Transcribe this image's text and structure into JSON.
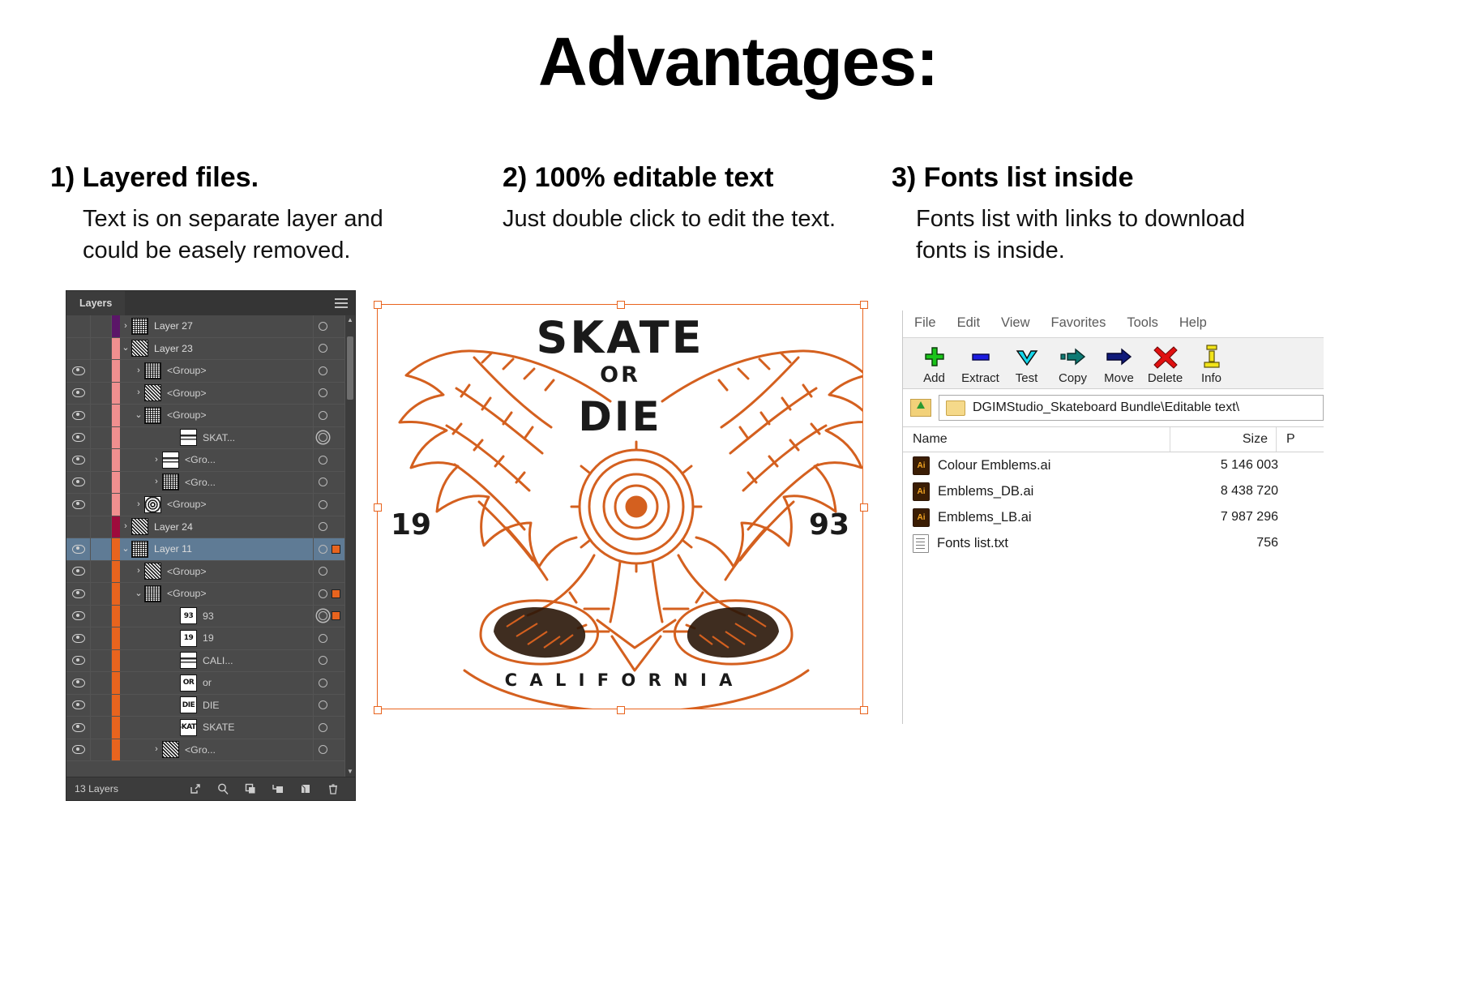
{
  "headline": "Advantages:",
  "columns": [
    {
      "title": "1) Layered files.",
      "body": "Text is on separate layer and could be easely removed."
    },
    {
      "title": "2) 100% editable text",
      "body": "Just double click to edit the text."
    },
    {
      "title": "3) Fonts list inside",
      "body": "Fonts list with links to download fonts is inside."
    }
  ],
  "layers_panel": {
    "tab_label": "Layers",
    "menu_icon": "hamburger-icon",
    "footer_count": "13 Layers",
    "footer_buttons": [
      "locate-object-icon",
      "make-clipping-mask-icon",
      "create-new-sublayer-icon",
      "create-new-layer-icon",
      "delete-selection-icon"
    ],
    "rows": [
      {
        "name": "Layer 27",
        "indent": 0,
        "arrow": ">",
        "eye": false,
        "color": "#5b1668",
        "selected": false,
        "thumb": "noise",
        "thumb_text": "",
        "extra_swatch": false,
        "target": "single"
      },
      {
        "name": "Layer 23",
        "indent": 0,
        "arrow": "v",
        "eye": false,
        "color": "#f08f8f",
        "selected": false,
        "thumb": "noise2",
        "thumb_text": "",
        "extra_swatch": false,
        "target": "single"
      },
      {
        "name": "<Group>",
        "indent": 1,
        "arrow": ">",
        "eye": true,
        "color": "#f08f8f",
        "selected": false,
        "thumb": "noise",
        "thumb_text": "",
        "extra_swatch": false,
        "target": "single"
      },
      {
        "name": "<Group>",
        "indent": 1,
        "arrow": ">",
        "eye": true,
        "color": "#f08f8f",
        "selected": false,
        "thumb": "noise2",
        "thumb_text": "",
        "extra_swatch": false,
        "target": "single"
      },
      {
        "name": "<Group>",
        "indent": 1,
        "arrow": "v",
        "eye": true,
        "color": "#f08f8f",
        "selected": false,
        "thumb": "noise",
        "thumb_text": "",
        "extra_swatch": false,
        "target": "single"
      },
      {
        "name": "SKAT...",
        "indent": 3,
        "arrow": "",
        "eye": true,
        "color": "#f08f8f",
        "selected": false,
        "thumb": "thin",
        "thumb_text": "",
        "extra_swatch": false,
        "target": "double"
      },
      {
        "name": "<Gro...",
        "indent": 2,
        "arrow": ">",
        "eye": true,
        "color": "#f08f8f",
        "selected": false,
        "thumb": "thin",
        "thumb_text": "",
        "extra_swatch": false,
        "target": "single"
      },
      {
        "name": "<Gro...",
        "indent": 2,
        "arrow": ">",
        "eye": true,
        "color": "#f08f8f",
        "selected": false,
        "thumb": "noise",
        "thumb_text": "",
        "extra_swatch": false,
        "target": "single"
      },
      {
        "name": "<Group>",
        "indent": 1,
        "arrow": ">",
        "eye": true,
        "color": "#f08f8f",
        "selected": false,
        "thumb": "ring",
        "thumb_text": "",
        "extra_swatch": false,
        "target": "single"
      },
      {
        "name": "Layer 24",
        "indent": 0,
        "arrow": ">",
        "eye": false,
        "color": "#9e0b3c",
        "selected": false,
        "thumb": "noise2",
        "thumb_text": "",
        "extra_swatch": false,
        "target": "single"
      },
      {
        "name": "Layer 11",
        "indent": 0,
        "arrow": "v",
        "eye": true,
        "color": "#e8641e",
        "selected": true,
        "thumb": "noise",
        "thumb_text": "",
        "extra_swatch": true,
        "target": "single"
      },
      {
        "name": "<Group>",
        "indent": 1,
        "arrow": ">",
        "eye": true,
        "color": "#e8641e",
        "selected": false,
        "thumb": "noise2",
        "thumb_text": "",
        "extra_swatch": false,
        "target": "single"
      },
      {
        "name": "<Group>",
        "indent": 1,
        "arrow": "v",
        "eye": true,
        "color": "#e8641e",
        "selected": false,
        "thumb": "noise",
        "thumb_text": "",
        "extra_swatch": true,
        "target": "single"
      },
      {
        "name": "93",
        "indent": 3,
        "arrow": "",
        "eye": true,
        "color": "#e8641e",
        "selected": false,
        "thumb": "text",
        "thumb_text": "93",
        "extra_swatch": true,
        "target": "double"
      },
      {
        "name": "19",
        "indent": 3,
        "arrow": "",
        "eye": true,
        "color": "#e8641e",
        "selected": false,
        "thumb": "text",
        "thumb_text": "19",
        "extra_swatch": false,
        "target": "single"
      },
      {
        "name": "CALI...",
        "indent": 3,
        "arrow": "",
        "eye": true,
        "color": "#e8641e",
        "selected": false,
        "thumb": "thin",
        "thumb_text": "",
        "extra_swatch": false,
        "target": "single"
      },
      {
        "name": "or",
        "indent": 3,
        "arrow": "",
        "eye": true,
        "color": "#e8641e",
        "selected": false,
        "thumb": "text",
        "thumb_text": "OR",
        "extra_swatch": false,
        "target": "single"
      },
      {
        "name": "DIE",
        "indent": 3,
        "arrow": "",
        "eye": true,
        "color": "#e8641e",
        "selected": false,
        "thumb": "text",
        "thumb_text": "DIE",
        "extra_swatch": false,
        "target": "single"
      },
      {
        "name": "SKATE",
        "indent": 3,
        "arrow": "",
        "eye": true,
        "color": "#e8641e",
        "selected": false,
        "thumb": "text",
        "thumb_text": "SKATE",
        "extra_swatch": false,
        "target": "single"
      },
      {
        "name": "<Gro...",
        "indent": 2,
        "arrow": ">",
        "eye": true,
        "color": "#e8641e",
        "selected": false,
        "thumb": "noise2",
        "thumb_text": "",
        "extra_swatch": false,
        "target": "single"
      }
    ]
  },
  "artwork": {
    "title_line1": "SKATE",
    "title_line2": "OR",
    "title_line3": "DIE",
    "year_left": "19",
    "year_right": "93",
    "bottom_arc": "C A L I F O R N I A",
    "accent_color": "#d4601f"
  },
  "file_manager": {
    "menu": [
      "File",
      "Edit",
      "View",
      "Favorites",
      "Tools",
      "Help"
    ],
    "toolbar": [
      {
        "label": "Add",
        "icon": "plus-icon",
        "color": "#19c419"
      },
      {
        "label": "Extract",
        "icon": "minus-icon",
        "color": "#1c1ce0"
      },
      {
        "label": "Test",
        "icon": "checkmark-icon",
        "color": "#16d6ea"
      },
      {
        "label": "Copy",
        "icon": "copy-arrow-icon",
        "color": "#0d7a74"
      },
      {
        "label": "Move",
        "icon": "move-arrow-icon",
        "color": "#101a7a"
      },
      {
        "label": "Delete",
        "icon": "cross-icon",
        "color": "#e01010"
      },
      {
        "label": "Info",
        "icon": "info-icon",
        "color": "#f2e41a"
      }
    ],
    "path": "DGIMStudio_Skateboard Bundle\\Editable text\\",
    "up_icon": "folder-up-icon",
    "path_icon": "folder-icon",
    "columns": [
      "Name",
      "Size",
      "P"
    ],
    "files": [
      {
        "name": "Colour Emblems.ai",
        "size": "5 146 003",
        "icon": "ai-file-icon"
      },
      {
        "name": "Emblems_DB.ai",
        "size": "8 438 720",
        "icon": "ai-file-icon"
      },
      {
        "name": "Emblems_LB.ai",
        "size": "7 987 296",
        "icon": "ai-file-icon"
      },
      {
        "name": "Fonts list.txt",
        "size": "756",
        "icon": "txt-file-icon"
      }
    ]
  }
}
